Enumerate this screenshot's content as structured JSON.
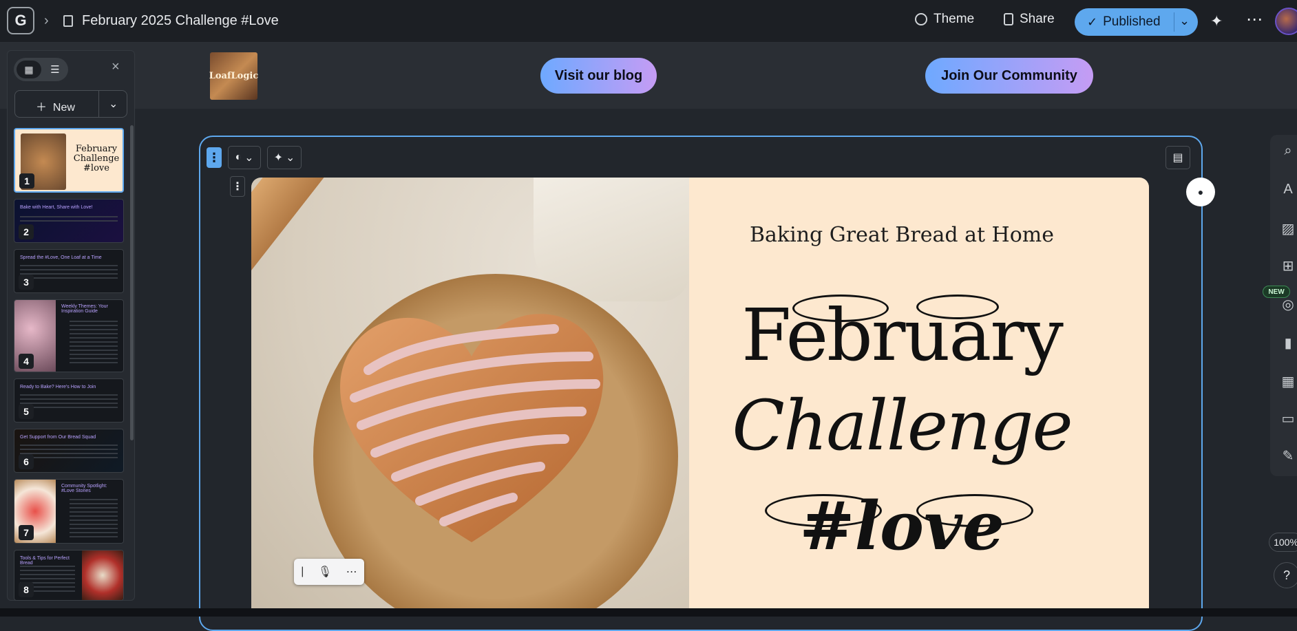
{
  "header": {
    "logo_letter": "G",
    "doc_title": "February 2025 Challenge #Love",
    "theme_label": "Theme",
    "share_label": "Share",
    "published_label": "Published"
  },
  "site_nav": {
    "brand_logo_text": "LoafLogic",
    "visit_blog": "Visit our blog",
    "join_community": "Join Our Community"
  },
  "sidebar": {
    "new_label": "New",
    "slides": [
      {
        "num": "1",
        "title": ""
      },
      {
        "num": "2",
        "title": "Bake with Heart, Share with Love!"
      },
      {
        "num": "3",
        "title": "Spread the #Love, One Loaf at a Time"
      },
      {
        "num": "4",
        "title": "Weekly Themes: Your Inspiration Guide"
      },
      {
        "num": "5",
        "title": "Ready to Bake? Here's How to Join"
      },
      {
        "num": "6",
        "title": "Get Support from Our Bread Squad"
      },
      {
        "num": "7",
        "title": "Community Spotlight: #Love Stories"
      },
      {
        "num": "8",
        "title": "Tools & Tips for Perfect Bread"
      }
    ]
  },
  "slide": {
    "subtitle": "Baking Great Bread at Home",
    "title_line1": "February",
    "title_line2": "Challenge",
    "title_line3": "#love"
  },
  "rail": {
    "new_tag": "NEW",
    "zoom": "100%",
    "help": "?"
  },
  "colors": {
    "accent": "#5ea8ee",
    "slide_bg": "#fde8cf",
    "pill_start": "#6ea9ff",
    "pill_end": "#c59cf4"
  }
}
